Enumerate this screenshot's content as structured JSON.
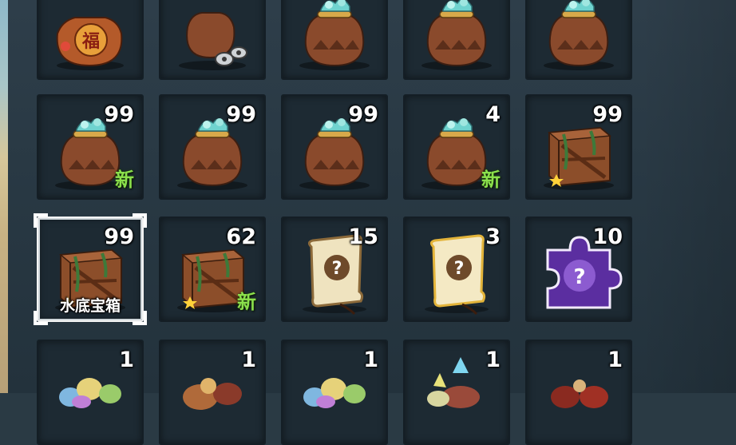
{
  "colors": {
    "panel_background": "#2a3a44",
    "slot_background": "#1d2a33",
    "count_text": "#ffffff",
    "new_badge": "#8be04c",
    "selection_frame": "#ffffff"
  },
  "inventory": {
    "rows": [
      {
        "slots": [
          {
            "item": "fortune-bag",
            "count": "",
            "is_new": false
          },
          {
            "item": "coin-pouch",
            "count": "",
            "is_new": false
          },
          {
            "item": "gem-sack",
            "count": "",
            "is_new": false
          },
          {
            "item": "gem-sack",
            "count": "",
            "is_new": false
          },
          {
            "item": "gem-sack",
            "count": "",
            "is_new": false
          }
        ]
      },
      {
        "slots": [
          {
            "item": "gem-sack",
            "count": "99",
            "is_new": true
          },
          {
            "item": "gem-sack",
            "count": "99",
            "is_new": false
          },
          {
            "item": "gem-sack",
            "count": "99",
            "is_new": false
          },
          {
            "item": "gem-sack",
            "count": "4",
            "is_new": true
          },
          {
            "item": "wooden-crate",
            "count": "99",
            "is_new": false
          }
        ]
      },
      {
        "slots": [
          {
            "item": "wooden-crate",
            "count": "99",
            "is_new": false,
            "selected": true,
            "name": "水底宝箱"
          },
          {
            "item": "wooden-crate",
            "count": "62",
            "is_new": true
          },
          {
            "item": "mystery-scroll",
            "count": "15",
            "is_new": false
          },
          {
            "item": "golden-mystery-scroll",
            "count": "3",
            "is_new": false
          },
          {
            "item": "purple-puzzle-piece",
            "count": "10",
            "is_new": false
          }
        ]
      },
      {
        "slots": [
          {
            "item": "egg-cluster",
            "count": "1",
            "is_new": false
          },
          {
            "item": "monster-bundle",
            "count": "1",
            "is_new": false
          },
          {
            "item": "egg-cluster",
            "count": "1",
            "is_new": false
          },
          {
            "item": "crystal-monster",
            "count": "1",
            "is_new": false
          },
          {
            "item": "red-monster-group",
            "count": "1",
            "is_new": false
          }
        ]
      }
    ]
  },
  "labels": {
    "new_badge": "新",
    "fortune_glyph": "福"
  }
}
